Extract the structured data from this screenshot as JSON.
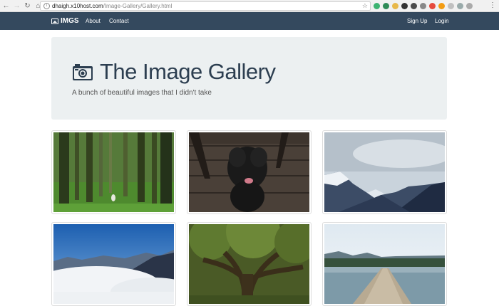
{
  "browser": {
    "url_host": "dhaigh.x10host.com",
    "url_path": "/Image-Gallery/Gallery.html"
  },
  "navbar": {
    "brand": "IMGS",
    "left_links": [
      "About",
      "Contact"
    ],
    "right_links": [
      "Sign Up",
      "Login"
    ]
  },
  "jumbotron": {
    "title": "The Image Gallery",
    "subtitle": "A bunch of beautiful images that I didn't take"
  },
  "gallery": {
    "images": [
      {
        "subject": "forest",
        "icon": "forest-photo"
      },
      {
        "subject": "black dog on wooden deck",
        "icon": "dog-photo"
      },
      {
        "subject": "snowy mountains under cloudy sky",
        "icon": "mountain-photo"
      },
      {
        "subject": "sea of clouds with mountain peaks",
        "icon": "clouds-photo"
      },
      {
        "subject": "old mossy tree",
        "icon": "tree-photo"
      },
      {
        "subject": "wooden pier on a lake",
        "icon": "pier-photo"
      }
    ]
  },
  "colors": {
    "navbar_bg": "#34495e",
    "jumbotron_bg": "#ecf0f1",
    "title_color": "#2c3e50"
  }
}
